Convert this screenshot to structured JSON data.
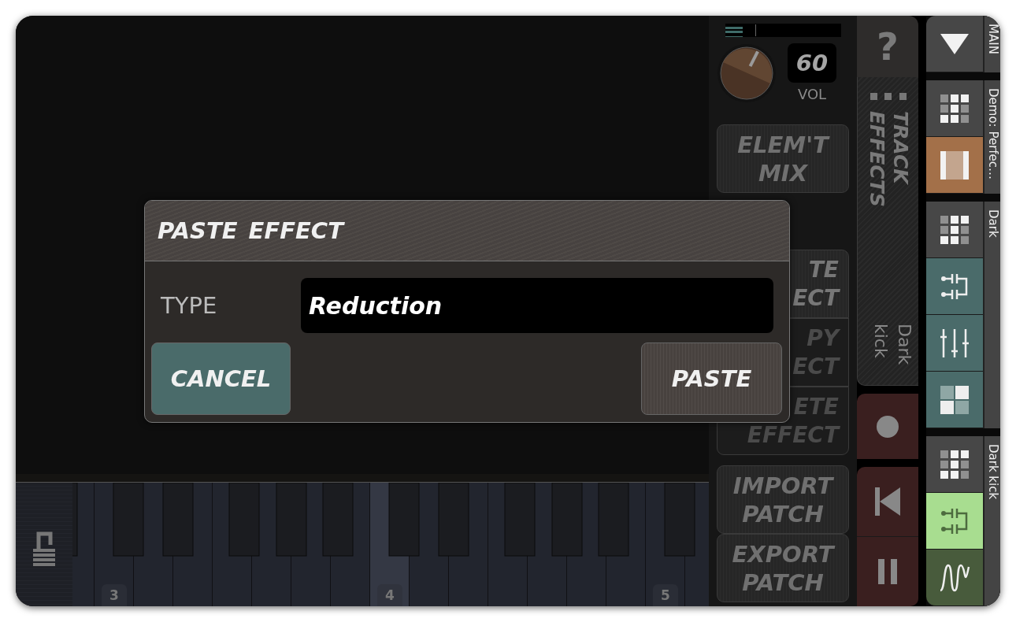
{
  "meter": {
    "level": 0.15
  },
  "volume": {
    "value": "60",
    "label": "VOL",
    "level": 0.6
  },
  "mix_groups": [
    [
      {
        "lines": [
          "ELEM'T",
          "MIX"
        ],
        "kind": "full"
      }
    ],
    [
      {
        "lines": [
          "TE",
          "ECT"
        ],
        "kind": "covered"
      },
      {
        "lines": [
          "PY",
          "ECT"
        ],
        "kind": "covered"
      },
      {
        "lines": [
          "ETE",
          "EFFECT"
        ],
        "kind": "covered"
      }
    ],
    [
      {
        "lines": [
          "IMPORT",
          "PATCH"
        ],
        "kind": "full"
      },
      {
        "lines": [
          "EXPORT",
          "PATCH"
        ],
        "kind": "full"
      }
    ]
  ],
  "help_button": "?",
  "track_effects": {
    "title": "TRACK EFFECTS",
    "track": "Dark kick"
  },
  "transport": [
    {
      "kind": "record"
    },
    {
      "kind": "skip_back"
    },
    {
      "kind": "pause"
    }
  ],
  "dialog": {
    "title": "PASTE EFFECT",
    "field_label": "TYPE",
    "value": "Reduction",
    "buttons": [
      {
        "label": "CANCEL",
        "kind": "cancel"
      },
      {
        "label": "PASTE",
        "kind": "paste"
      }
    ]
  },
  "lock": {
    "locked": false
  },
  "piano": {
    "octaves": [
      {
        "label": "3",
        "selected": false
      },
      {
        "label": "4",
        "selected": true
      },
      {
        "label": "5",
        "selected": false
      }
    ]
  },
  "right_panel": [
    {
      "label": "MAIN",
      "buttons": [
        {
          "kind": "menu",
          "color": "#474747"
        }
      ]
    },
    {
      "label": "Demo: Perfec…",
      "buttons": [
        {
          "kind": "grid",
          "color": "#474747"
        },
        {
          "kind": "pattern",
          "color": "#a37049"
        }
      ]
    },
    {
      "label": "Dark",
      "buttons": [
        {
          "kind": "grid",
          "color": "#474747"
        },
        {
          "kind": "routing",
          "color": "#4a6b6a"
        },
        {
          "kind": "sliders",
          "color": "#4a6b6a"
        },
        {
          "kind": "squares",
          "color": "#4a6b6a"
        }
      ]
    },
    {
      "label": "Dark kick",
      "buttons": [
        {
          "kind": "grid",
          "color": "#474747"
        },
        {
          "kind": "routing",
          "color": "#a8dd90"
        },
        {
          "kind": "wave",
          "color": "#485b3c"
        }
      ]
    }
  ]
}
